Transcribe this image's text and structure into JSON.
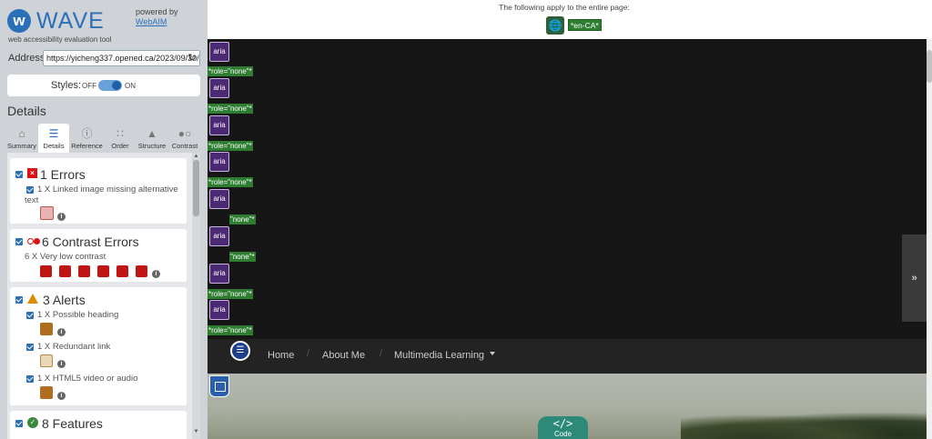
{
  "sidebar": {
    "logo": {
      "mark": "w",
      "word": "WAVE",
      "subtitle": "web accessibility evaluation tool"
    },
    "powered_by": {
      "text": "powered by",
      "link": "WebAIM"
    },
    "address": {
      "label": "Address:",
      "value": "https://yicheng337.opened.ca/2023/09/30/e"
    },
    "styles": {
      "label": "Styles:",
      "off": "OFF",
      "on": "ON"
    },
    "details_heading": "Details",
    "tabs": [
      {
        "label": "Summary",
        "icon": "home-icon"
      },
      {
        "label": "Details",
        "icon": "list-icon"
      },
      {
        "label": "Reference",
        "icon": "info-icon"
      },
      {
        "label": "Order",
        "icon": "order-icon"
      },
      {
        "label": "Structure",
        "icon": "structure-icon"
      },
      {
        "label": "Contrast",
        "icon": "contrast-icon"
      }
    ],
    "categories": {
      "errors": {
        "title": "1 Errors",
        "items": [
          {
            "text": "1 X Linked image missing alternative text"
          }
        ]
      },
      "contrast": {
        "title": "6 Contrast Errors",
        "items": [
          {
            "text": "6 X Very low contrast"
          }
        ]
      },
      "alerts": {
        "title": "3 Alerts",
        "items": [
          {
            "text": "1 X Possible heading"
          },
          {
            "text": "1 X Redundant link"
          },
          {
            "text": "1 X HTML5 video or audio"
          }
        ]
      },
      "features": {
        "title": "8 Features"
      }
    },
    "info_glyph": "i"
  },
  "main": {
    "page_note": "The following apply to the entire page:",
    "lang_tag": "*en-CA*",
    "aria_label": "aria",
    "role_tags": [
      "*role=\"none\"*",
      "*role=\"none\"*",
      "*role=\"none\"*",
      "*role=\"none\"*",
      "\"none\"*",
      "\"none\"*",
      "*role=\"none\"*",
      "*role=\"none\"*"
    ],
    "expand_glyph": "»",
    "nav": {
      "links": [
        "Home",
        "About Me",
        "Multimedia Learning"
      ],
      "separator": "/"
    },
    "code_tab": {
      "icon": "</>",
      "label": "Code"
    }
  },
  "colors": {
    "wave_blue": "#2a6fb8",
    "aria_purple": "#4b2a73",
    "tag_green": "#2e7d32",
    "error_red": "#d11111",
    "code_teal": "#2e8a78"
  }
}
